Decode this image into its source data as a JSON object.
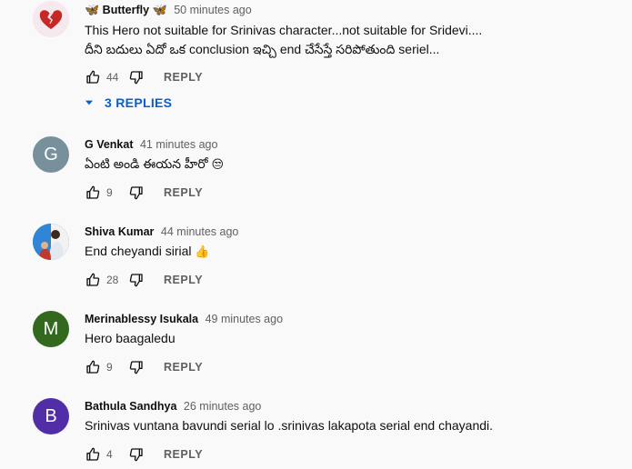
{
  "comments": [
    {
      "author": "Butterfly",
      "author_prefix_emoji": "🦋",
      "author_suffix_emoji": "🦋",
      "timestamp": "50 minutes ago",
      "avatar": {
        "kind": "image",
        "icon": "broken-heart-icon"
      },
      "text_lines": [
        "This Hero not suitable for Srinivas character...not suitable for Sridevi....",
        "దీని బదులు ఏదో ఒక conclusion ఇచ్చి end చేసేస్తే సరిపోతుంది seriel..."
      ],
      "likes": "44",
      "reply_label": "REPLY"
    },
    {
      "author": "G Venkat",
      "timestamp": "41 minutes ago",
      "avatar": {
        "kind": "letter",
        "letter": "G",
        "color": "#78909c"
      },
      "text": "ఏంటి అండి ఈయన హీరో",
      "text_emoji": "😒",
      "likes": "9",
      "reply_label": "REPLY"
    },
    {
      "author": "Shiva Kumar",
      "timestamp": "44 minutes ago",
      "avatar": {
        "kind": "image",
        "icon": "photo-avatar-icon"
      },
      "text": "End cheyandi sirial",
      "text_emoji": "👍",
      "likes": "28",
      "reply_label": "REPLY"
    },
    {
      "author": "Merinablessy Isukala",
      "timestamp": "49 minutes ago",
      "avatar": {
        "kind": "letter",
        "letter": "M",
        "color": "#33691e"
      },
      "text": "Hero baagaledu",
      "likes": "9",
      "reply_label": "REPLY"
    },
    {
      "author": "Bathula Sandhya",
      "timestamp": "26 minutes ago",
      "avatar": {
        "kind": "letter",
        "letter": "B",
        "color": "#512da8"
      },
      "text": "Srinivas vuntana bavundi serial lo .srinivas lakapota serial end chayandi.",
      "likes": "4",
      "reply_label": "REPLY"
    }
  ],
  "replies_toggle": {
    "label": "3 REPLIES",
    "icon": "chevron-down-icon"
  },
  "colors": {
    "link_blue": "#065fd4",
    "secondary_text": "#606060",
    "background": "#f9f9f9"
  }
}
